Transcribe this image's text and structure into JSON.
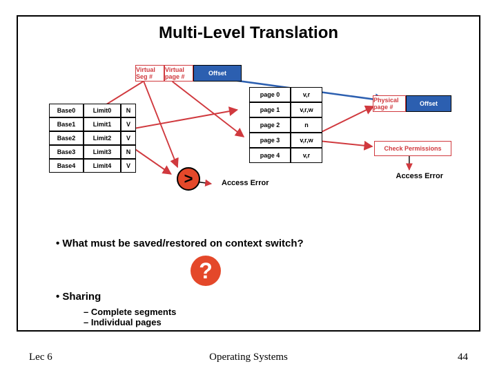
{
  "title": "Multi-Level Translation",
  "va": {
    "seg": "Virtual\nSeg #",
    "page": "Virtual\npage #",
    "off": "Offset"
  },
  "seg": {
    "rows": [
      {
        "base": "Base0",
        "lim": "Limit0",
        "v": "N"
      },
      {
        "base": "Base1",
        "lim": "Limit1",
        "v": "V"
      },
      {
        "base": "Base2",
        "lim": "Limit2",
        "v": "V"
      },
      {
        "base": "Base3",
        "lim": "Limit3",
        "v": "N"
      },
      {
        "base": "Base4",
        "lim": "Limit4",
        "v": "V"
      }
    ]
  },
  "cmp": ">",
  "pt": {
    "rows": [
      {
        "p": "page 0",
        "perm": "v,r"
      },
      {
        "p": "page 1",
        "perm": "v,r,w"
      },
      {
        "p": "page 2",
        "perm": "n"
      },
      {
        "p": "page 3",
        "perm": "v,r,w"
      },
      {
        "p": "page 4",
        "perm": "v,r"
      }
    ]
  },
  "phys": {
    "pp": "Physical\npage #",
    "off": "Offset"
  },
  "checkp": "Check Permissions",
  "ae": "Access Error",
  "bullets": {
    "q1": "What must be saved/restored on context switch?",
    "q2": "Sharing",
    "sub1": "Complete segments",
    "sub2": "Individual pages"
  },
  "qmark": "?",
  "footer": {
    "left": "Lec 6",
    "center": "Operating Systems",
    "right": "44"
  }
}
